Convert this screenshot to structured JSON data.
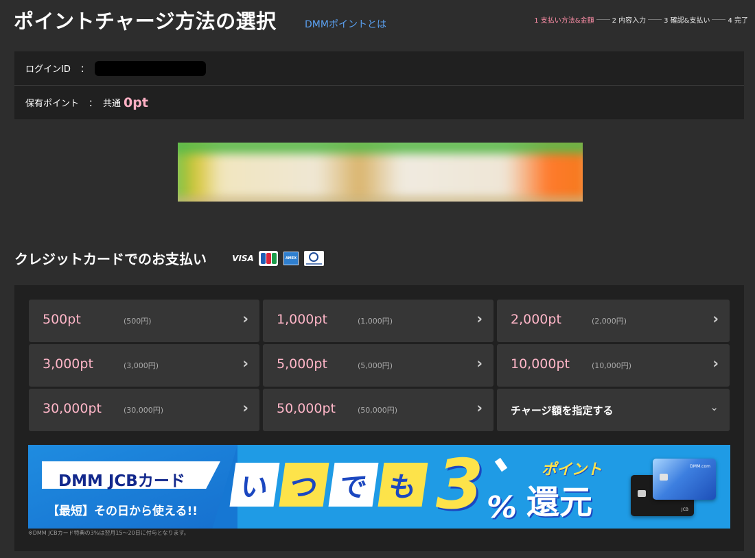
{
  "header": {
    "title": "ポイントチャージ方法の選択",
    "about_link": "DMMポイントとは",
    "steps": [
      {
        "label": "1 支払い方法&金額",
        "active": true
      },
      {
        "label": "2 内容入力",
        "active": false
      },
      {
        "label": "3 確認&支払い",
        "active": false
      },
      {
        "label": "4 完了",
        "active": false
      }
    ]
  },
  "account": {
    "login_label": "ログインID",
    "colon": "：",
    "points_label": "保有ポイント",
    "points_prefix": "共通",
    "points_value": "0pt"
  },
  "credit_section": {
    "title": "クレジットカードでのお支払い",
    "brands": [
      "VISA",
      "JCB",
      "AMERICAN EXPRESS",
      "Diners Club"
    ],
    "options": [
      {
        "points": "500pt",
        "yen": "(500円)"
      },
      {
        "points": "1,000pt",
        "yen": "(1,000円)"
      },
      {
        "points": "2,000pt",
        "yen": "(2,000円)"
      },
      {
        "points": "3,000pt",
        "yen": "(3,000円)"
      },
      {
        "points": "5,000pt",
        "yen": "(5,000円)"
      },
      {
        "points": "10,000pt",
        "yen": "(10,000円)"
      },
      {
        "points": "30,000pt",
        "yen": "(30,000円)"
      },
      {
        "points": "50,000pt",
        "yen": "(50,000円)"
      }
    ],
    "custom_amount": "チャージ額を指定する"
  },
  "jcb_banner": {
    "tag": "DMM JCBカード",
    "sub": "【最短】その日から使える!!",
    "tiles": [
      "い",
      "つ",
      "で",
      "も"
    ],
    "rate": "3",
    "percent": "%",
    "point_word": "ポイント",
    "return_word": "還元",
    "note": "※DMM JCBカード特典の3%は翌月15～20日に付与となります。"
  },
  "colors": {
    "background": "#2d2d2d",
    "panel": "#202020",
    "option_tile": "#363636",
    "accent_pink": "#ffb6c8",
    "step_active": "#ff8fa8",
    "link_blue": "#5aa0f0",
    "banner_blue": "#1f9be5",
    "banner_yellow": "#fde34a"
  }
}
